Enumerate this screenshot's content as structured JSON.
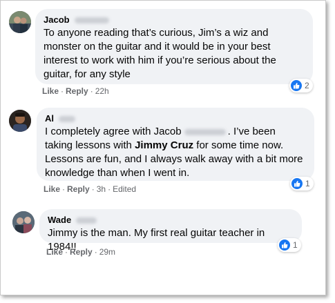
{
  "comments": [
    {
      "author": "Jacob",
      "text": "To anyone reading that’s curious, Jim’s a wiz and monster on the guitar and it would be in your best interest to work with him if you’re serious about the guitar, for any style",
      "actions": {
        "like": "Like",
        "reply": "Reply",
        "time": "22h"
      },
      "reaction_count": "2",
      "reaction_icon": "thumbs-up-icon",
      "avatar_colors": [
        "#2e3a4a",
        "#7a8a70"
      ]
    },
    {
      "author": "Al",
      "text_parts": {
        "before_name": "I completely agree with Jacob",
        "after_name": ". I’ve been taking lessons with ",
        "bold": "Jimmy Cruz",
        "after_bold": " for some time now. Lessons are fun, and I always walk away with a bit more knowledge than when I went in."
      },
      "actions": {
        "like": "Like",
        "reply": "Reply",
        "time": "3h",
        "edited": "Edited"
      },
      "reaction_count": "1",
      "reaction_icon": "thumbs-up-icon",
      "avatar_colors": [
        "#2a2420",
        "#9a6a4a"
      ]
    },
    {
      "author": "Wade",
      "text": "Jimmy is the man. My first real guitar teacher in 1984!!",
      "actions": {
        "like": "Like",
        "reply": "Reply",
        "time": "29m"
      },
      "reaction_count": "1",
      "reaction_icon": "thumbs-up-icon",
      "avatar_colors": [
        "#5a6a78",
        "#c8a898"
      ]
    }
  ],
  "colors": {
    "bubble": "#f0f2f5",
    "meta_text": "#65676b",
    "like_blue": "#1877f2"
  }
}
